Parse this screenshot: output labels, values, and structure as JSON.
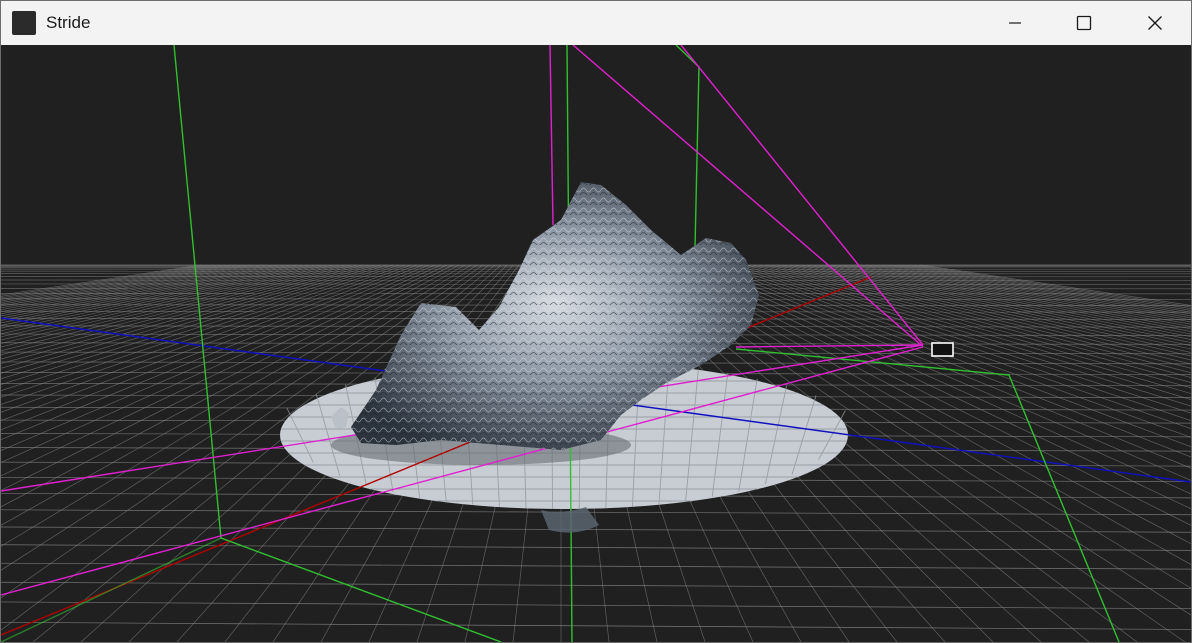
{
  "window": {
    "title": "Stride",
    "controls": [
      "minimize-icon",
      "maximize-icon",
      "close-icon"
    ]
  },
  "viewport": {
    "background": "#202020",
    "grid_color": "#8a8a8a",
    "axis_colors": {
      "x": "#b00000",
      "y": "#00a000",
      "z": "#1010c0"
    },
    "camera_frustum_color": "#e020d0",
    "light_bounds_color": "#30c030",
    "platform_color": "#c8cdd3"
  }
}
